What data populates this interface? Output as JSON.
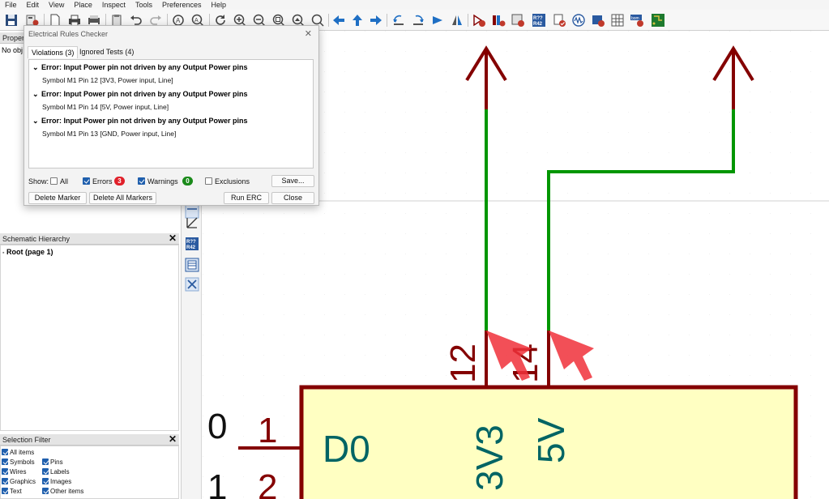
{
  "menu": [
    "File",
    "Edit",
    "View",
    "Place",
    "Inspect",
    "Tools",
    "Preferences",
    "Help"
  ],
  "properties_panel": {
    "title": "Proper",
    "body_text": "No obj"
  },
  "hierarchy_panel": {
    "title": "Schematic Hierarchy",
    "close": "✕",
    "root_item": "Root (page 1)"
  },
  "selection_filter": {
    "title": "Selection Filter",
    "close": "✕",
    "items": [
      {
        "label": "All items",
        "checked": true
      },
      {
        "label": "Symbols",
        "checked": true
      },
      {
        "label": "Pins",
        "checked": true
      },
      {
        "label": "Wires",
        "checked": true
      },
      {
        "label": "Labels",
        "checked": true
      },
      {
        "label": "Graphics",
        "checked": true
      },
      {
        "label": "Images",
        "checked": true
      },
      {
        "label": "Text",
        "checked": true
      },
      {
        "label": "Other items",
        "checked": true
      }
    ]
  },
  "erc_dialog": {
    "title": "Electrical Rules Checker",
    "close": "✕",
    "tabs": [
      "Violations (3)",
      "Ignored Tests (4)"
    ],
    "violations": [
      {
        "error": "Error: Input Power pin not driven by any Output Power pins",
        "detail": "Symbol M1 Pin 12 [3V3, Power input, Line]"
      },
      {
        "error": "Error: Input Power pin not driven by any Output Power pins",
        "detail": "Symbol M1 Pin 14 [5V, Power input, Line]"
      },
      {
        "error": "Error: Input Power pin not driven by any Output Power pins",
        "detail": "Symbol M1 Pin 13 [GND, Power input, Line]"
      }
    ],
    "show_label": "Show:",
    "filters": {
      "all": {
        "label": "All",
        "checked": false
      },
      "errors": {
        "label": "Errors",
        "checked": true,
        "count": "3",
        "color": "#e0202a"
      },
      "warnings": {
        "label": "Warnings",
        "checked": true,
        "count": "0",
        "color": "#1a8a1a"
      },
      "exclusions": {
        "label": "Exclusions",
        "checked": false
      }
    },
    "buttons": {
      "save": "Save...",
      "delete_marker": "Delete Marker",
      "delete_all_markers": "Delete All Markers",
      "run_erc": "Run ERC",
      "close": "Close"
    }
  },
  "schematic": {
    "pin_numbers": [
      "12",
      "14",
      "1",
      "2"
    ],
    "pin_names": [
      "3V3",
      "5V",
      "D0"
    ],
    "partial_left_labels": [
      "0",
      "1"
    ],
    "colors": {
      "power_symbol": "#840000",
      "wire": "#009600",
      "component_body": "#ffffc2",
      "component_outline": "#840000",
      "pin_text": "#006464",
      "marker": "#f0303a"
    }
  }
}
